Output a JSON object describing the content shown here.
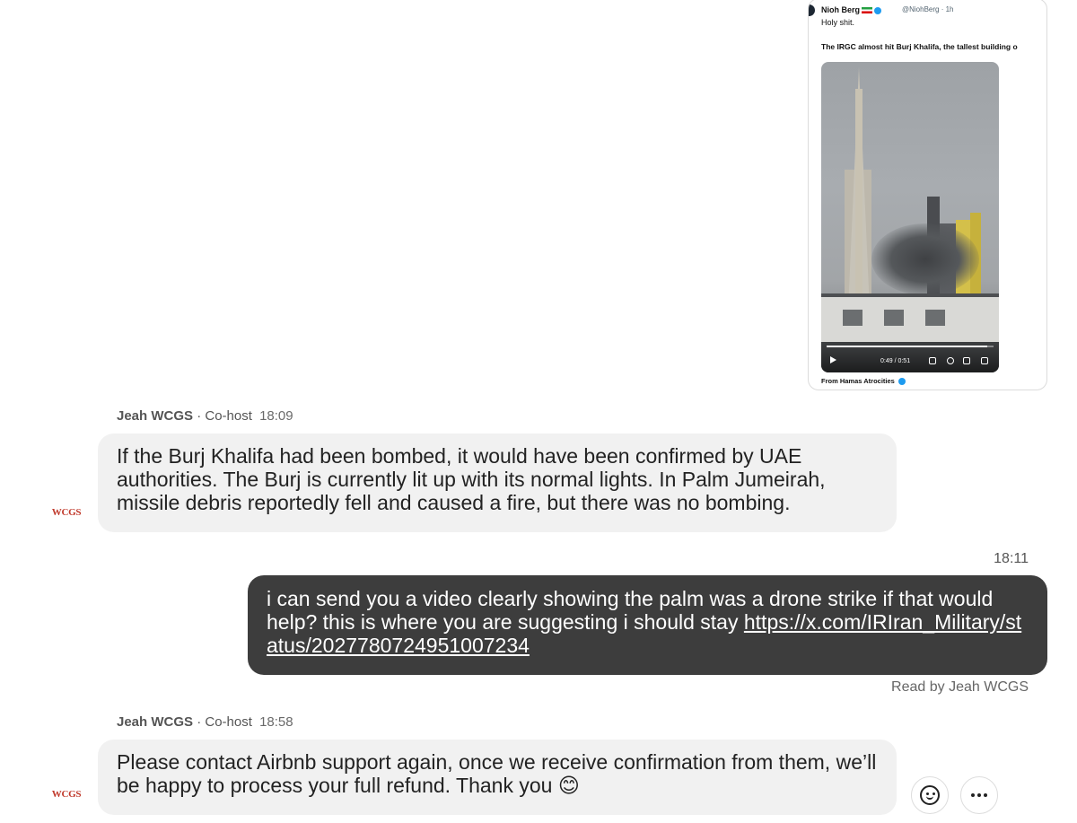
{
  "tweet": {
    "author": "Nioh Berg",
    "handle_time": "@NiohBerg · 1h",
    "line1": "Holy shit.",
    "line2": "The IRGC  almost hit Burj Khalifa, the tallest building o",
    "video_time": "0:49 / 0:51",
    "video_progress": 0.96,
    "footer": "From Hamas Atrocities"
  },
  "messages": [
    {
      "sender": "Jeah WCGS",
      "role": "· Co-host",
      "time": "18:09",
      "avatar_text": "WCGS",
      "text": "If the Burj Khalifa had been bombed, it would have been confirmed by UAE authorities. The Burj is currently lit up with its normal lights. In Palm Jumeirah, missile debris reportedly fell and caused a fire, but there was no bombing."
    },
    {
      "time": "18:11",
      "text": "i can send you a video clearly showing the palm was a drone strike if that would help? this is where you are suggesting i should stay ",
      "link": "https://x.com/IRIran_Military/status/2027780724951007234",
      "read_receipt": "Read by Jeah WCGS"
    },
    {
      "sender": "Jeah WCGS",
      "role": "· Co-host",
      "time": "18:58",
      "avatar_text": "WCGS",
      "text": "Please contact Airbnb support again, once we receive confirmation from them, we’ll be happy to process your full refund. Thank you 😊"
    }
  ],
  "actions": {
    "react": "emoji-reaction",
    "more": "more-options"
  }
}
